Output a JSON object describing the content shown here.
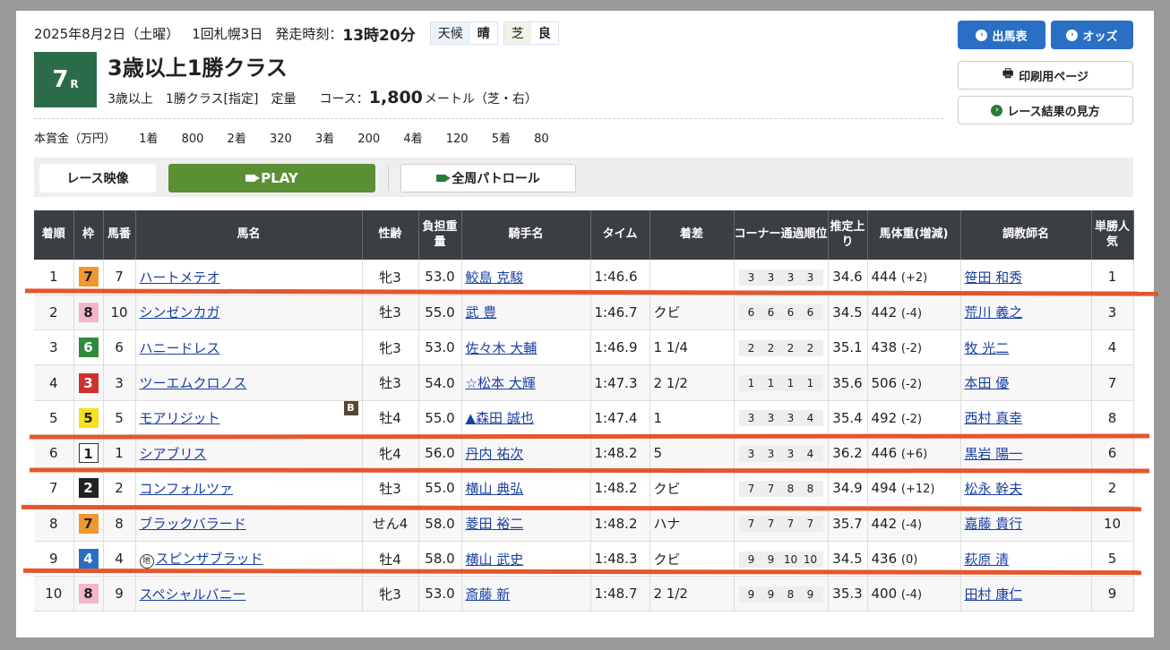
{
  "race_info": {
    "date": "2025年8月2日（土曜）",
    "meeting": "1回札幌3日",
    "start_label": "発走時刻：",
    "start_time": "13時20分",
    "weather_label": "天候",
    "weather": "晴",
    "surface_label": "芝",
    "going": "良"
  },
  "race": {
    "number": "7",
    "number_suffix": "R",
    "title": "3歳以上1勝クラス",
    "age": "3歳以上",
    "class": "1勝クラス[指定]",
    "weight_rule": "定量",
    "course_label": "コース：",
    "distance": "1,800",
    "distance_unit": "メートル（芝・右）"
  },
  "prize": {
    "label": "本賞金（万円）",
    "items": [
      "1着",
      "800",
      "2着",
      "320",
      "3着",
      "200",
      "4着",
      "120",
      "5着",
      "80"
    ]
  },
  "buttons": {
    "entries": "出馬表",
    "odds": "オッズ",
    "print": "印刷用ページ",
    "howto": "レース結果の見方"
  },
  "video": {
    "label": "レース映像",
    "play": "PLAY",
    "patrol": "全周パトロール"
  },
  "table": {
    "headers": [
      "着順",
      "枠",
      "馬番",
      "馬名",
      "性齢",
      "負担重量",
      "騎手名",
      "タイム",
      "着差",
      "コーナー通過順位",
      "推定上り",
      "馬体重(増減)",
      "調教師名",
      "単勝人気"
    ],
    "rows": [
      {
        "rank": "1",
        "waku": "7",
        "umaban": "7",
        "horse": "ハートメテオ",
        "sexage": "牝3",
        "weight": "53.0",
        "jockey": "鮫島 克駿",
        "time": "1:46.6",
        "margin": "",
        "corners": [
          "3",
          "3",
          "3",
          "3"
        ],
        "last3f": "34.6",
        "bw": "444",
        "bwdiff": "(+2)",
        "trainer": "笹田 和秀",
        "pop": "1"
      },
      {
        "rank": "2",
        "waku": "8",
        "umaban": "10",
        "horse": "シンゼンカガ",
        "sexage": "牡3",
        "weight": "55.0",
        "jockey": "武 豊",
        "time": "1:46.7",
        "margin": "クビ",
        "corners": [
          "6",
          "6",
          "6",
          "6"
        ],
        "last3f": "34.5",
        "bw": "442",
        "bwdiff": "(-4)",
        "trainer": "荒川 義之",
        "pop": "3"
      },
      {
        "rank": "3",
        "waku": "6",
        "umaban": "6",
        "horse": "ハニードレス",
        "sexage": "牝3",
        "weight": "53.0",
        "jockey": "佐々木 大輔",
        "time": "1:46.9",
        "margin": "1 1/4",
        "corners": [
          "2",
          "2",
          "2",
          "2"
        ],
        "last3f": "35.1",
        "bw": "438",
        "bwdiff": "(-2)",
        "trainer": "牧 光二",
        "pop": "4"
      },
      {
        "rank": "4",
        "waku": "3",
        "umaban": "3",
        "horse": "ツーエムクロノス",
        "sexage": "牡3",
        "weight": "54.0",
        "jockey": "☆松本 大輝",
        "time": "1:47.3",
        "margin": "2 1/2",
        "corners": [
          "1",
          "1",
          "1",
          "1"
        ],
        "last3f": "35.6",
        "bw": "506",
        "bwdiff": "(-2)",
        "trainer": "本田 優",
        "pop": "7"
      },
      {
        "rank": "5",
        "waku": "5",
        "umaban": "5",
        "horse": "モアリジット",
        "blinker": "B",
        "sexage": "牡4",
        "weight": "55.0",
        "jockey": "▲森田 誠也",
        "time": "1:47.4",
        "margin": "1",
        "corners": [
          "3",
          "3",
          "3",
          "4"
        ],
        "last3f": "35.4",
        "bw": "492",
        "bwdiff": "(-2)",
        "trainer": "西村 真幸",
        "pop": "8"
      },
      {
        "rank": "6",
        "waku": "1",
        "umaban": "1",
        "horse": "シアブリス",
        "sexage": "牝4",
        "weight": "56.0",
        "jockey": "丹内 祐次",
        "time": "1:48.2",
        "margin": "5",
        "corners": [
          "3",
          "3",
          "3",
          "4"
        ],
        "last3f": "36.2",
        "bw": "446",
        "bwdiff": "(+6)",
        "trainer": "黒岩 陽一",
        "pop": "6"
      },
      {
        "rank": "7",
        "waku": "2",
        "umaban": "2",
        "horse": "コンフォルツァ",
        "sexage": "牡3",
        "weight": "55.0",
        "jockey": "横山 典弘",
        "time": "1:48.2",
        "margin": "クビ",
        "corners": [
          "7",
          "7",
          "8",
          "8"
        ],
        "last3f": "34.9",
        "bw": "494",
        "bwdiff": "(+12)",
        "trainer": "松永 幹夫",
        "pop": "2"
      },
      {
        "rank": "8",
        "waku": "7",
        "umaban": "8",
        "horse": "ブラックバラード",
        "sexage": "せん4",
        "weight": "58.0",
        "jockey": "菱田 裕二",
        "time": "1:48.2",
        "margin": "ハナ",
        "corners": [
          "7",
          "7",
          "7",
          "7"
        ],
        "last3f": "35.7",
        "bw": "442",
        "bwdiff": "(-4)",
        "trainer": "嘉藤 貴行",
        "pop": "10"
      },
      {
        "rank": "9",
        "waku": "4",
        "umaban": "4",
        "horse": "スピンザブラッド",
        "chi": "地",
        "sexage": "牡4",
        "weight": "58.0",
        "jockey": "横山 武史",
        "time": "1:48.3",
        "margin": "クビ",
        "corners": [
          "9",
          "9",
          "10",
          "10"
        ],
        "last3f": "34.5",
        "bw": "436",
        "bwdiff": "(0)",
        "trainer": "萩原 清",
        "pop": "5"
      },
      {
        "rank": "10",
        "waku": "8",
        "umaban": "9",
        "horse": "スペシャルバニー",
        "sexage": "牝3",
        "weight": "53.0",
        "jockey": "斎藤 新",
        "time": "1:48.7",
        "margin": "2 1/2",
        "corners": [
          "9",
          "9",
          "8",
          "9"
        ],
        "last3f": "35.3",
        "bw": "400",
        "bwdiff": "(-4)",
        "trainer": "田村 康仁",
        "pop": "9"
      }
    ]
  },
  "waku_colors": {
    "1": {
      "bg": "#ffffff",
      "fg": "#222222"
    },
    "2": {
      "bg": "#222222",
      "fg": "#ffffff"
    },
    "3": {
      "bg": "#d0312d",
      "fg": "#ffffff"
    },
    "4": {
      "bg": "#2a6fc4",
      "fg": "#ffffff"
    },
    "5": {
      "bg": "#f5e11b",
      "fg": "#222222"
    },
    "6": {
      "bg": "#2e8b3d",
      "fg": "#ffffff"
    },
    "7": {
      "bg": "#f0982f",
      "fg": "#222222"
    },
    "8": {
      "bg": "#f3b6c8",
      "fg": "#222222"
    }
  },
  "colors": {
    "race_badge": "#2a6b4a",
    "accent_blue": "#2a6fc4",
    "play_green": "#5b8f33",
    "header_dark": "#3b3f44",
    "annotation_red": "#e4562d"
  }
}
